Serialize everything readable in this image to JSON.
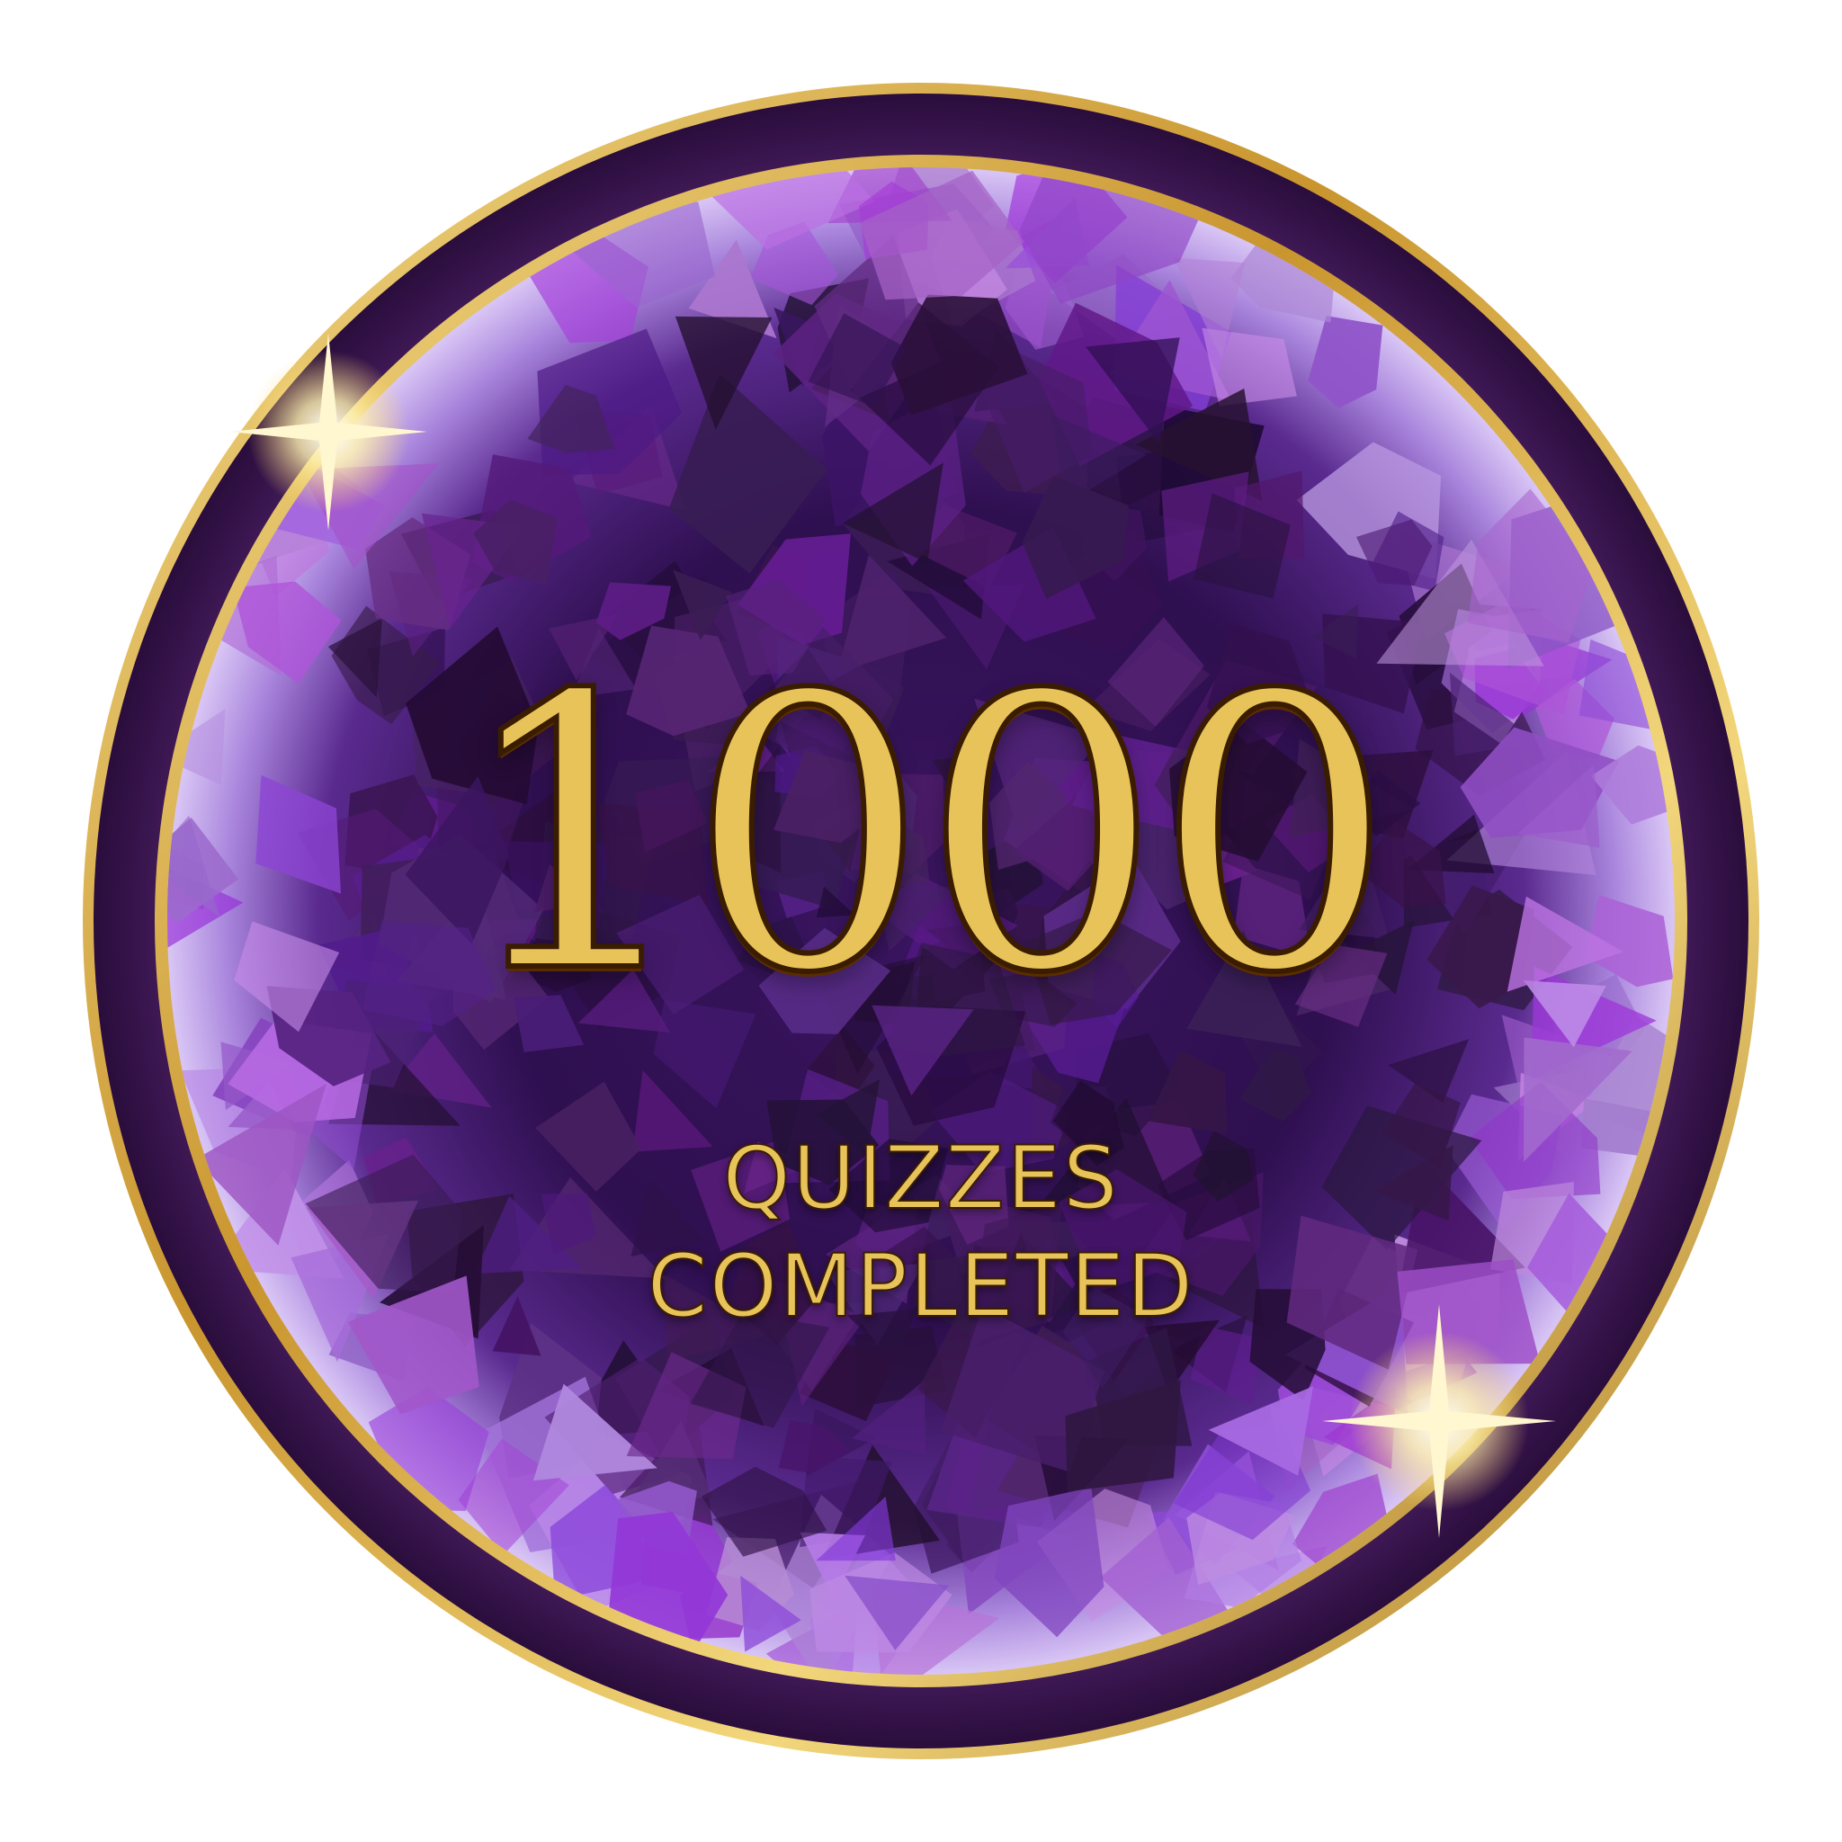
{
  "badge": {
    "count": "1000",
    "line1": "QUIZZES",
    "line2": "COMPLETED"
  },
  "colors": {
    "gold": "#e8c35a",
    "gold_dark": "#9c6a16",
    "ring_purple": "#3d1850",
    "crystal_dark": "#2a0f45",
    "crystal_mid": "#5b2a8c",
    "crystal_light": "#c8a8f0"
  },
  "icons": [
    "sparkle-icon",
    "sparkle-icon"
  ]
}
